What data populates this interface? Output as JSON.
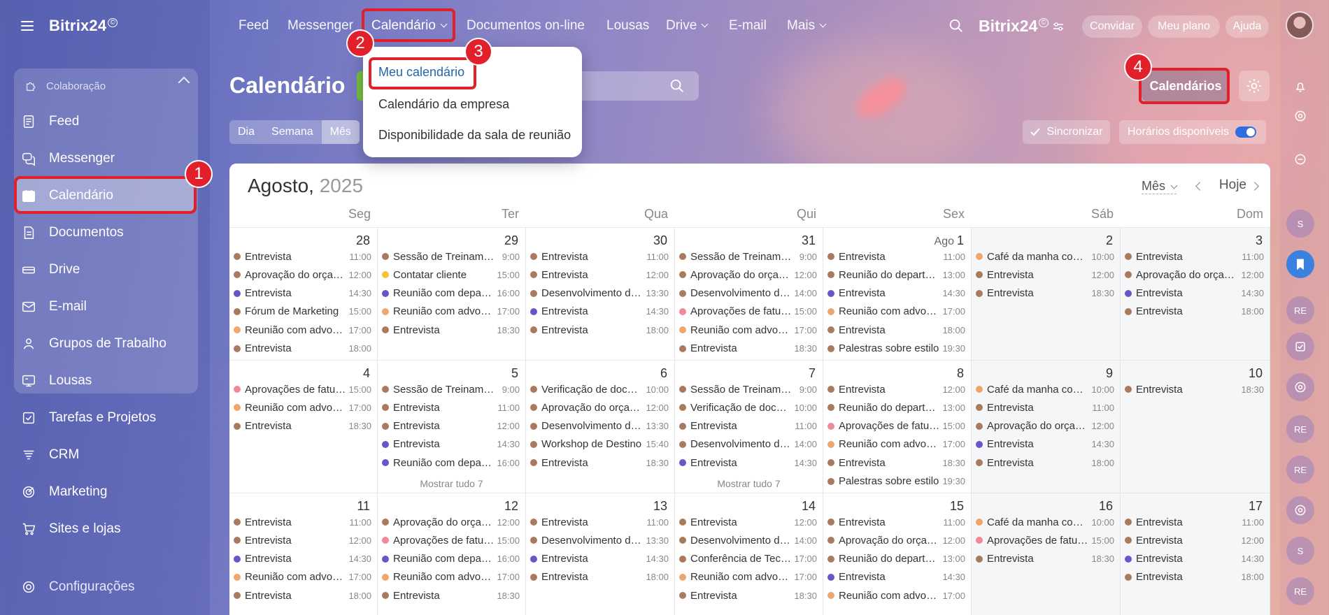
{
  "app": {
    "logo": "Bitrix24",
    "logo_mark": "©"
  },
  "sidebar": {
    "group_label": "Colaboração",
    "items": [
      {
        "label": "Feed",
        "icon": "feed-icon"
      },
      {
        "label": "Messenger",
        "icon": "messenger-icon"
      },
      {
        "label": "Calendário",
        "icon": "calendar-icon"
      },
      {
        "label": "Documentos",
        "icon": "document-icon"
      },
      {
        "label": "Drive",
        "icon": "drive-icon"
      },
      {
        "label": "E-mail",
        "icon": "mail-icon"
      },
      {
        "label": "Grupos de Trabalho",
        "icon": "group-icon"
      },
      {
        "label": "Lousas",
        "icon": "board-icon"
      },
      {
        "label": "Tarefas e Projetos",
        "icon": "task-icon"
      },
      {
        "label": "CRM",
        "icon": "crm-icon"
      },
      {
        "label": "Marketing",
        "icon": "marketing-icon"
      },
      {
        "label": "Sites e lojas",
        "icon": "cart-icon"
      }
    ],
    "settings_label": "Configurações"
  },
  "topnav": {
    "items": [
      "Feed",
      "Messenger",
      "Calendário",
      "Documentos on-line",
      "Lousas",
      "Drive",
      "E-mail",
      "Mais"
    ],
    "brand": "Bitrix24",
    "invite": "Convidar",
    "plan": "Meu plano",
    "help": "Ajuda"
  },
  "dropdown": {
    "items": [
      "Meu calendário",
      "Calendário da empresa",
      "Disponibilidade da sala de reunião"
    ]
  },
  "page": {
    "title": "Calendário",
    "views": [
      "Dia",
      "Semana",
      "Mês"
    ],
    "active_view": "Mês",
    "sync_label": "Sincronizar",
    "hours_label": "Horários disponíveis",
    "calendars_button": "Calendários"
  },
  "badges": [
    "1",
    "2",
    "3",
    "4"
  ],
  "colors": {
    "annotation": "#e2202c",
    "ev_brown": "#a97a5e",
    "ev_purple": "#6a55c8",
    "ev_orange": "#f0a66a",
    "ev_pink": "#ee8a9a",
    "ev_yellow": "#f4c430",
    "toggle": "#2f6de1"
  },
  "calendar": {
    "month": "Agosto,",
    "year": "2025",
    "view_select": "Mês",
    "today": "Hoje",
    "weekdays": [
      "Seg",
      "Ter",
      "Qua",
      "Qui",
      "Sex",
      "Sáb",
      "Dom"
    ],
    "weeks": [
      [
        {
          "day": "28",
          "events": [
            [
              "Entrevista",
              "11:00",
              "b"
            ],
            [
              "Aprovação do orçamento",
              "12:00",
              "b"
            ],
            [
              "Entrevista",
              "14:30",
              "p"
            ],
            [
              "Fórum de Marketing",
              "15:00",
              "b"
            ],
            [
              "Reunião com advogados",
              "17:00",
              "o"
            ],
            [
              "Entrevista",
              "18:00",
              "b"
            ]
          ]
        },
        {
          "day": "29",
          "events": [
            [
              "Sessão de Treinamento",
              "9:00",
              "b"
            ],
            [
              "Contatar cliente",
              "15:00",
              "y"
            ],
            [
              "Reunião com departamento",
              "16:00",
              "p"
            ],
            [
              "Reunião com advogados",
              "17:00",
              "o"
            ],
            [
              "Entrevista",
              "18:30",
              "b"
            ]
          ]
        },
        {
          "day": "30",
          "events": [
            [
              "Entrevista",
              "11:00",
              "b"
            ],
            [
              "Entrevista",
              "12:00",
              "b"
            ],
            [
              "Desenvolvimento do produto",
              "13:30",
              "b"
            ],
            [
              "Entrevista",
              "14:30",
              "p"
            ],
            [
              "Entrevista",
              "18:00",
              "b"
            ]
          ]
        },
        {
          "day": "31",
          "events": [
            [
              "Sessão de Treinamento",
              "9:00",
              "b"
            ],
            [
              "Aprovação do orçamento",
              "12:00",
              "b"
            ],
            [
              "Desenvolvimento do produto",
              "14:00",
              "b"
            ],
            [
              "Aprovações de faturas",
              "15:00",
              "k"
            ],
            [
              "Reunião com advogados",
              "17:00",
              "o"
            ],
            [
              "Entrevista",
              "18:30",
              "b"
            ]
          ]
        },
        {
          "day": "1",
          "month_label": "Ago",
          "events": [
            [
              "Entrevista",
              "11:00",
              "b"
            ],
            [
              "Reunião do departamento",
              "13:00",
              "b"
            ],
            [
              "Entrevista",
              "14:30",
              "p"
            ],
            [
              "Reunião com advogados",
              "17:00",
              "o"
            ],
            [
              "Entrevista",
              "18:00",
              "b"
            ],
            [
              "Palestras sobre estilo",
              "19:30",
              "b"
            ]
          ]
        },
        {
          "day": "2",
          "events": [
            [
              "Café da manha com equipe",
              "10:00",
              "o"
            ],
            [
              "Entrevista",
              "12:00",
              "b"
            ],
            [
              "Entrevista",
              "18:30",
              "b"
            ]
          ]
        },
        {
          "day": "3",
          "events": [
            [
              "Entrevista",
              "11:00",
              "b"
            ],
            [
              "Aprovação do orçamento",
              "12:00",
              "b"
            ],
            [
              "Entrevista",
              "14:30",
              "p"
            ],
            [
              "Entrevista",
              "18:00",
              "b"
            ]
          ]
        }
      ],
      [
        {
          "day": "4",
          "events": [
            [
              "Aprovações de faturas",
              "15:00",
              "k"
            ],
            [
              "Reunião com advogados",
              "17:00",
              "o"
            ],
            [
              "Entrevista",
              "18:30",
              "b"
            ]
          ]
        },
        {
          "day": "5",
          "more": "Mostrar tudo 7",
          "events": [
            [
              "Sessão de Treinamento",
              "9:00",
              "b"
            ],
            [
              "Entrevista",
              "11:00",
              "b"
            ],
            [
              "Entrevista",
              "12:00",
              "b"
            ],
            [
              "Entrevista",
              "14:30",
              "p"
            ],
            [
              "Reunião com departamento",
              "16:00",
              "p"
            ]
          ]
        },
        {
          "day": "6",
          "events": [
            [
              "Verificação de documentos",
              "10:00",
              "b"
            ],
            [
              "Aprovação do orçamento",
              "12:00",
              "b"
            ],
            [
              "Desenvolvimento do produto",
              "13:30",
              "b"
            ],
            [
              "Workshop de Destino",
              "15:40",
              "b"
            ],
            [
              "Entrevista",
              "18:30",
              "b"
            ]
          ]
        },
        {
          "day": "7",
          "more": "Mostrar tudo 7",
          "events": [
            [
              "Sessão de Treinamento",
              "9:00",
              "b"
            ],
            [
              "Verificação de documentos",
              "10:00",
              "b"
            ],
            [
              "Entrevista",
              "11:00",
              "b"
            ],
            [
              "Desenvolvimento do produto",
              "14:00",
              "b"
            ],
            [
              "Entrevista",
              "14:30",
              "p"
            ]
          ]
        },
        {
          "day": "8",
          "events": [
            [
              "Entrevista",
              "12:00",
              "b"
            ],
            [
              "Reunião do departamento",
              "13:00",
              "b"
            ],
            [
              "Aprovações de faturas",
              "15:00",
              "k"
            ],
            [
              "Reunião com advogados",
              "17:00",
              "o"
            ],
            [
              "Entrevista",
              "18:30",
              "b"
            ],
            [
              "Palestras sobre estilo",
              "19:30",
              "b"
            ]
          ]
        },
        {
          "day": "9",
          "events": [
            [
              "Café da manha com equipe",
              "10:00",
              "o"
            ],
            [
              "Entrevista",
              "11:00",
              "b"
            ],
            [
              "Aprovação do orçamento",
              "12:00",
              "b"
            ],
            [
              "Entrevista",
              "14:30",
              "p"
            ],
            [
              "Entrevista",
              "18:00",
              "b"
            ]
          ]
        },
        {
          "day": "10",
          "events": [
            [
              "Entrevista",
              "18:30",
              "b"
            ]
          ]
        }
      ],
      [
        {
          "day": "11",
          "events": [
            [
              "Entrevista",
              "11:00",
              "b"
            ],
            [
              "Entrevista",
              "12:00",
              "b"
            ],
            [
              "Entrevista",
              "14:30",
              "p"
            ],
            [
              "Reunião com advogados",
              "17:00",
              "o"
            ],
            [
              "Entrevista",
              "18:00",
              "b"
            ]
          ]
        },
        {
          "day": "12",
          "events": [
            [
              "Aprovação do orçamento",
              "12:00",
              "b"
            ],
            [
              "Aprovações de faturas",
              "15:00",
              "k"
            ],
            [
              "Reunião com departamento",
              "16:00",
              "p"
            ],
            [
              "Reunião com advogados",
              "17:00",
              "o"
            ],
            [
              "Entrevista",
              "18:30",
              "b"
            ]
          ]
        },
        {
          "day": "13",
          "events": [
            [
              "Entrevista",
              "11:00",
              "b"
            ],
            [
              "Desenvolvimento do produto",
              "13:30",
              "b"
            ],
            [
              "Entrevista",
              "14:30",
              "p"
            ],
            [
              "Entrevista",
              "18:00",
              "b"
            ]
          ]
        },
        {
          "day": "14",
          "events": [
            [
              "Entrevista",
              "12:00",
              "b"
            ],
            [
              "Desenvolvimento do produto",
              "14:00",
              "b"
            ],
            [
              "Conferência de Tecnologia",
              "17:00",
              "b"
            ],
            [
              "Reunião com advogados",
              "17:00",
              "o"
            ],
            [
              "Entrevista",
              "18:30",
              "b"
            ]
          ]
        },
        {
          "day": "15",
          "events": [
            [
              "Entrevista",
              "11:00",
              "b"
            ],
            [
              "Aprovação do orçamento",
              "12:00",
              "b"
            ],
            [
              "Reunião do departamento",
              "13:00",
              "b"
            ],
            [
              "Entrevista",
              "14:30",
              "p"
            ],
            [
              "Reunião com advogados",
              "17:00",
              "o"
            ]
          ]
        },
        {
          "day": "16",
          "events": [
            [
              "Café da manha com equipe",
              "10:00",
              "o"
            ],
            [
              "Aprovações de faturas",
              "15:00",
              "k"
            ],
            [
              "Entrevista",
              "18:30",
              "b"
            ]
          ]
        },
        {
          "day": "17",
          "events": [
            [
              "Entrevista",
              "11:00",
              "b"
            ],
            [
              "Entrevista",
              "12:00",
              "b"
            ],
            [
              "Entrevista",
              "14:30",
              "p"
            ],
            [
              "Entrevista",
              "18:00",
              "b"
            ]
          ]
        }
      ]
    ]
  },
  "rightrail": [
    "bell-icon",
    "target-icon",
    "chat-icon",
    "S",
    "bookmark-icon",
    "RE",
    "check-icon",
    "target-icon",
    "RE",
    "RE",
    "target-icon",
    "S",
    "RE"
  ]
}
